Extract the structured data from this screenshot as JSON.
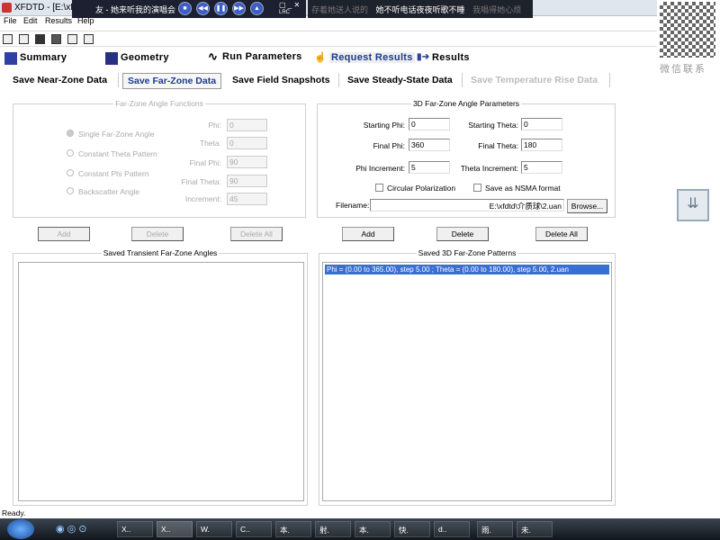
{
  "window": {
    "title": "XFDTD - [E:\\xf"
  },
  "player": {
    "song": "友 - 她来听我的演唱会",
    "lyric_prev": "存着她送人说的",
    "lyric_current": "她不听电话夜夜听歌不睡",
    "lyric_next": "我唱得她心烦",
    "lrc": "LRC"
  },
  "menu": [
    "File",
    "Edit",
    "Results",
    "Help"
  ],
  "main_tabs": [
    "Summary",
    "Geometry",
    "Run Parameters",
    "Request Results",
    "Results"
  ],
  "sub_tabs": [
    {
      "label": "Save Near-Zone Data"
    },
    {
      "label": "Save Far-Zone Data"
    },
    {
      "label": "Save Field Snapshots"
    },
    {
      "label": "Save Steady-State Data"
    },
    {
      "label": "Save Temperature Rise Data"
    }
  ],
  "transient": {
    "legend": "Far-Zone Angle Functions",
    "options": [
      "Single Far-Zone Angle",
      "Constant Theta Pattern",
      "Constant Phi Pattern",
      "Backscatter Angle"
    ],
    "fields": [
      {
        "label": "Phi:",
        "value": "0"
      },
      {
        "label": "Theta:",
        "value": "0"
      },
      {
        "label": "Final Phi:",
        "value": "90"
      },
      {
        "label": "Final Theta:",
        "value": "90"
      },
      {
        "label": "Increment:",
        "value": "45"
      }
    ],
    "buttons": [
      "Add",
      "Delete",
      "Delete All"
    ],
    "list_title": "Saved Transient Far-Zone Angles"
  },
  "pattern3d": {
    "legend": "3D Far-Zone Angle Parameters",
    "starting_phi_label": "Starting Phi:",
    "starting_phi": "0",
    "starting_theta_label": "Starting Theta:",
    "starting_theta": "0",
    "final_phi_label": "Final Phi:",
    "final_phi": "360",
    "final_theta_label": "Final Theta:",
    "final_theta": "180",
    "phi_inc_label": "Phi Increment:",
    "phi_inc": "5",
    "theta_inc_label": "Theta Increment:",
    "theta_inc": "5",
    "circular_label": "Circular Polarization",
    "nsma_label": "Save as NSMA format",
    "filename_label": "Filename:",
    "filename": "E:\\xfdtd\\介质球\\2.uan",
    "browse": "Browse...",
    "buttons": [
      "Add",
      "Delete",
      "Delete All"
    ],
    "list_title": "Saved 3D Far-Zone Patterns",
    "items": [
      "Phi = (0.00 to 365.00), step 5.00 ; Theta = (0.00 to 180.00), step 5.00, 2.uan"
    ]
  },
  "status": "Ready.",
  "side": {
    "qr_caption": "微信联系"
  },
  "taskbar": [
    "X..",
    "X..",
    "W.",
    "C..",
    "本.",
    "射.",
    "本.",
    "快.",
    "d..",
    "雨.",
    "未."
  ]
}
